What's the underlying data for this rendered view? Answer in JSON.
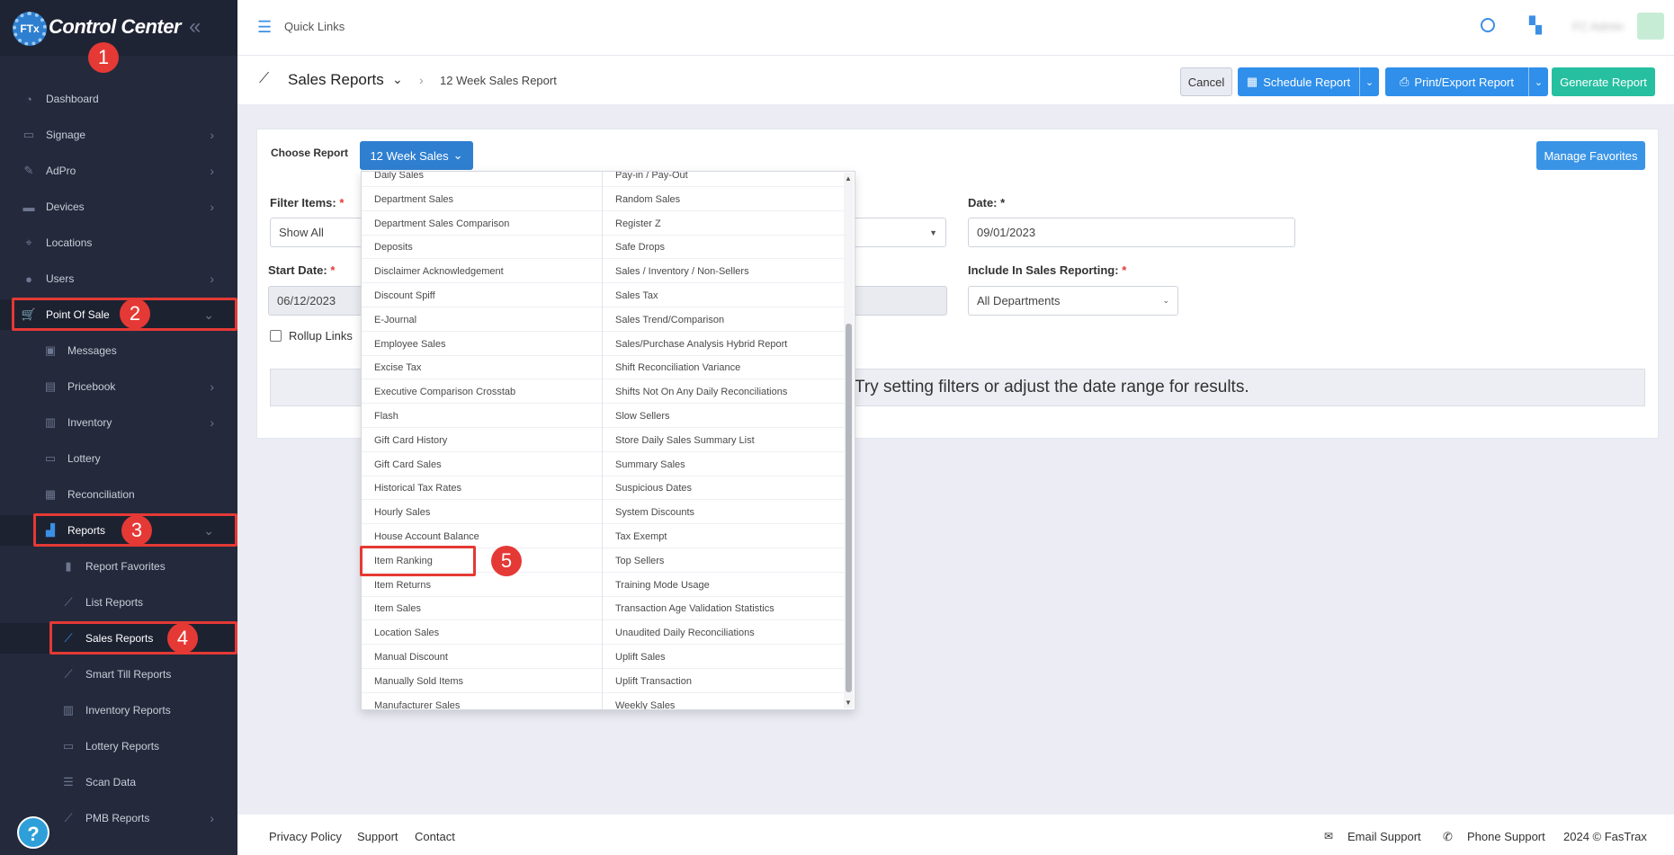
{
  "sidebar": {
    "title": "Control Center",
    "logo_text": "FTx",
    "items": [
      {
        "label": "Dashboard",
        "icon": "gauge-icon"
      },
      {
        "label": "Signage",
        "icon": "monitor-icon"
      },
      {
        "label": "AdPro",
        "icon": "brush-icon"
      },
      {
        "label": "Devices",
        "icon": "devices-icon"
      },
      {
        "label": "Locations",
        "icon": "map-pin-icon"
      },
      {
        "label": "Users",
        "icon": "users-icon"
      },
      {
        "label": "Point Of Sale",
        "icon": "cart-icon"
      },
      {
        "label": "Messages",
        "icon": "message-icon"
      },
      {
        "label": "Pricebook",
        "icon": "book-icon"
      },
      {
        "label": "Inventory",
        "icon": "inventory-icon"
      },
      {
        "label": "Lottery",
        "icon": "ticket-icon"
      },
      {
        "label": "Reconciliation",
        "icon": "grid-icon"
      },
      {
        "label": "Reports",
        "icon": "bar-chart-icon"
      },
      {
        "label": "Report Favorites",
        "icon": "bookmark-icon"
      },
      {
        "label": "List Reports",
        "icon": "line-chart-icon"
      },
      {
        "label": "Sales Reports",
        "icon": "line-chart-icon"
      },
      {
        "label": "Smart Till Reports",
        "icon": "line-chart-icon"
      },
      {
        "label": "Inventory Reports",
        "icon": "inventory-icon"
      },
      {
        "label": "Lottery Reports",
        "icon": "ticket-icon"
      },
      {
        "label": "Scan Data",
        "icon": "list-icon"
      },
      {
        "label": "PMB Reports",
        "icon": "chart-icon"
      }
    ],
    "help": "?"
  },
  "annotations": [
    "1",
    "2",
    "3",
    "4",
    "5"
  ],
  "topbar": {
    "quick_links": "Quick Links",
    "user_name": "FC Admin"
  },
  "header": {
    "title": "Sales Reports",
    "breadcrumb": "12 Week Sales Report",
    "cancel": "Cancel",
    "schedule": "Schedule Report",
    "print_export": "Print/Export Report",
    "generate": "Generate Report"
  },
  "form": {
    "choose_report_label": "Choose Report",
    "choose_report_value": "12 Week Sales",
    "manage_favorites": "Manage Favorites",
    "filter_items_label": "Filter Items:",
    "filter_items_value": "Show All",
    "start_date_label": "Start Date:",
    "start_date_value": "06/12/2023",
    "date_label": "Date: *",
    "date_value": "09/01/2023",
    "include_label": "Include In Sales Reporting:",
    "include_value": "All Departments",
    "required_mark": "*",
    "rollup_label": "Rollup Links",
    "empty_message": "Try setting filters or adjust the date range for results."
  },
  "dropdown": {
    "col0": [
      "Daily Sales",
      "Department Sales",
      "Department Sales Comparison",
      "Deposits",
      "Disclaimer Acknowledgement",
      "Discount Spiff",
      "E-Journal",
      "Employee Sales",
      "Excise Tax",
      "Executive Comparison Crosstab",
      "Flash",
      "Gift Card History",
      "Gift Card Sales",
      "Historical Tax Rates",
      "Hourly Sales",
      "House Account Balance",
      "Item Ranking",
      "Item Returns",
      "Item Sales",
      "Location Sales",
      "Manual Discount",
      "Manually Sold Items",
      "Manufacturer Sales"
    ],
    "col1": [
      "Pay-in / Pay-Out",
      "Random Sales",
      "Register Z",
      "Safe Drops",
      "Sales / Inventory / Non-Sellers",
      "Sales Tax",
      "Sales Trend/Comparison",
      "Sales/Purchase Analysis Hybrid Report",
      "Shift Reconciliation Variance",
      "Shifts Not On Any Daily Reconciliations",
      "Slow Sellers",
      "Store Daily Sales Summary List",
      "Summary Sales",
      "Suspicious Dates",
      "System Discounts",
      "Tax Exempt",
      "Top Sellers",
      "Training Mode Usage",
      "Transaction Age Validation Statistics",
      "Unaudited Daily Reconciliations",
      "Uplift Sales",
      "Uplift Transaction",
      "Weekly Sales"
    ]
  },
  "footer": {
    "privacy": "Privacy Policy",
    "support": "Support",
    "contact": "Contact",
    "email_support": "Email Support",
    "phone_support": "Phone Support",
    "copyright": "2024 © FasTrax"
  }
}
